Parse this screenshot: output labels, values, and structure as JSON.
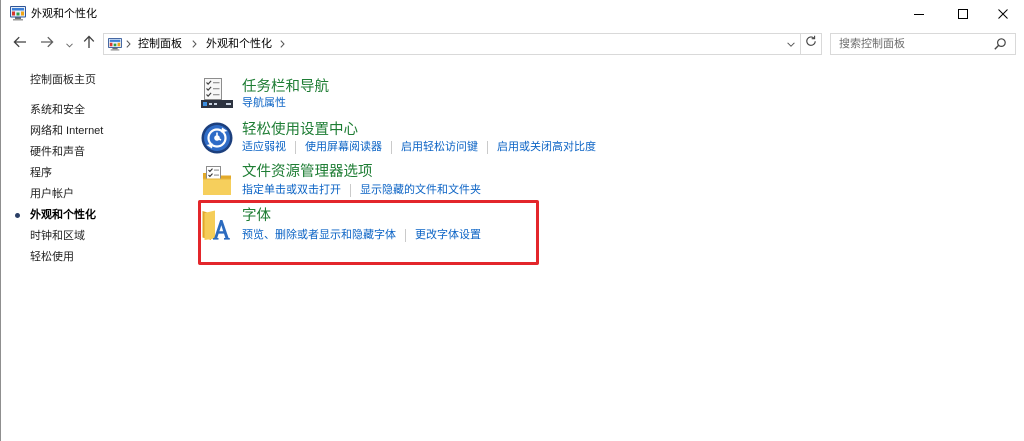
{
  "window": {
    "title": "外观和个性化",
    "app_icon": "control-panel-icon"
  },
  "window_controls": {
    "icons": [
      "minimize-icon",
      "maximize-icon",
      "close-icon"
    ]
  },
  "nav": {
    "icons": [
      "back-arrow-icon",
      "forward-arrow-icon",
      "recent-locations-chevron-icon",
      "up-arrow-icon"
    ]
  },
  "address_bar": {
    "icon": "control-panel-icon",
    "breadcrumbs": [
      "控制面板",
      "外观和个性化"
    ],
    "separator_icon": "chevron-right-icon",
    "dropdown_icon": "chevron-down-icon",
    "refresh_icon": "refresh-icon"
  },
  "search": {
    "placeholder": "搜索控制面板",
    "icon": "search-icon"
  },
  "sidebar": {
    "home": "控制面板主页",
    "items": [
      {
        "label": "系统和安全"
      },
      {
        "label": "网络和 Internet"
      },
      {
        "label": "硬件和声音"
      },
      {
        "label": "程序"
      },
      {
        "label": "用户帐户"
      },
      {
        "label": "外观和个性化",
        "current": true
      },
      {
        "label": "时钟和区域"
      },
      {
        "label": "轻松使用"
      }
    ]
  },
  "categories": [
    {
      "title": "任务栏和导航",
      "icon": "taskbar-navigation-icon",
      "links": [
        "导航属性"
      ]
    },
    {
      "title": "轻松使用设置中心",
      "icon": "ease-of-access-icon",
      "links": [
        "适应弱视",
        "使用屏幕阅读器",
        "启用轻松访问键",
        "启用或关闭高对比度"
      ]
    },
    {
      "title": "文件资源管理器选项",
      "icon": "folder-options-icon",
      "links": [
        "指定单击或双击打开",
        "显示隐藏的文件和文件夹"
      ]
    },
    {
      "title": "字体",
      "icon": "fonts-folder-icon",
      "icon_lettering": "A",
      "links": [
        "预览、删除或者显示和隐藏字体",
        "更改字体设置"
      ]
    }
  ],
  "highlight": {
    "color": "#e3262b"
  },
  "colors": {
    "category_title": "#1e7d34",
    "link": "#0b63c5",
    "sidebar_text": "#222222"
  }
}
